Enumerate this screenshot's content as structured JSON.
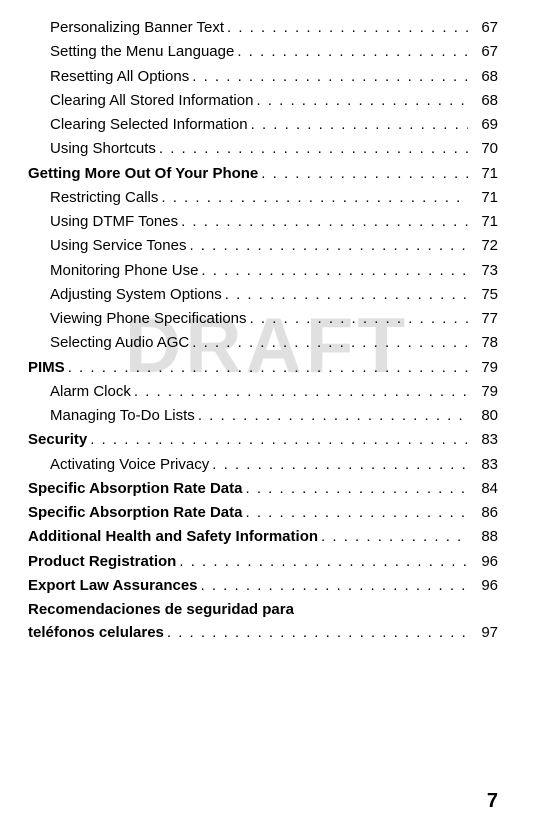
{
  "watermark": "DRAFT",
  "page_number": "7",
  "toc": [
    {
      "label": "Personalizing Banner Text",
      "page": "67",
      "bold": false,
      "sub": true
    },
    {
      "label": "Setting the Menu Language",
      "page": "67",
      "bold": false,
      "sub": true
    },
    {
      "label": "Resetting All Options",
      "page": "68",
      "bold": false,
      "sub": true
    },
    {
      "label": "Clearing All Stored Information",
      "page": "68",
      "bold": false,
      "sub": true
    },
    {
      "label": "Clearing Selected Information",
      "page": "69",
      "bold": false,
      "sub": true
    },
    {
      "label": "Using Shortcuts",
      "page": "70",
      "bold": false,
      "sub": true
    },
    {
      "label": "Getting More Out Of Your Phone",
      "page": "71",
      "bold": true,
      "sub": false
    },
    {
      "label": "Restricting Calls",
      "page": "71",
      "bold": false,
      "sub": true
    },
    {
      "label": "Using DTMF Tones",
      "page": "71",
      "bold": false,
      "sub": true
    },
    {
      "label": "Using Service Tones",
      "page": "72",
      "bold": false,
      "sub": true
    },
    {
      "label": "Monitoring Phone Use",
      "page": "73",
      "bold": false,
      "sub": true
    },
    {
      "label": "Adjusting System Options",
      "page": "75",
      "bold": false,
      "sub": true
    },
    {
      "label": "Viewing Phone Specifications",
      "page": "77",
      "bold": false,
      "sub": true
    },
    {
      "label": "Selecting Audio AGC",
      "page": "78",
      "bold": false,
      "sub": true
    },
    {
      "label": "PIMS",
      "page": "79",
      "bold": true,
      "sub": false
    },
    {
      "label": "Alarm Clock",
      "page": "79",
      "bold": false,
      "sub": true
    },
    {
      "label": "Managing To-Do Lists",
      "page": "80",
      "bold": false,
      "sub": true
    },
    {
      "label": "Security",
      "page": "83",
      "bold": true,
      "sub": false
    },
    {
      "label": "Activating Voice Privacy",
      "page": "83",
      "bold": false,
      "sub": true
    },
    {
      "label": "Specific Absorption Rate Data",
      "page": "84",
      "bold": true,
      "sub": false
    },
    {
      "label": "Specific Absorption Rate Data",
      "page": "86",
      "bold": true,
      "sub": false
    },
    {
      "label": "Additional Health and Safety Information",
      "page": "88",
      "bold": true,
      "sub": false
    },
    {
      "label": "Product Registration",
      "page": "96",
      "bold": true,
      "sub": false
    },
    {
      "label": "Export Law Assurances",
      "page": "96",
      "bold": true,
      "sub": false
    }
  ],
  "multi_entry": {
    "line1": "Recomendaciones de seguridad para",
    "line2": "teléfonos celulares",
    "page": "97"
  }
}
